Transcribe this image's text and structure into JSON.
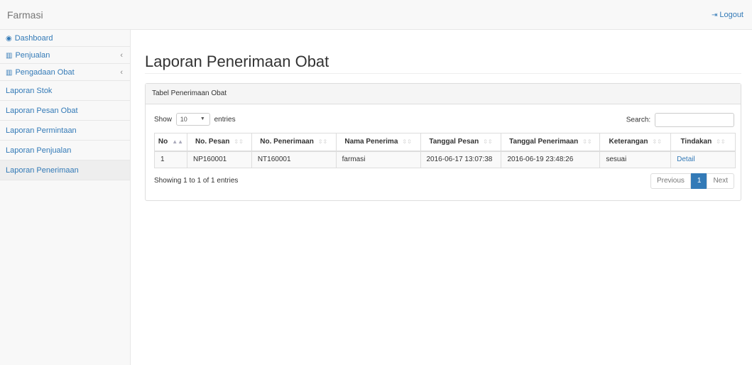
{
  "brand": "Farmasi",
  "logout_label": "Logout",
  "sidebar": {
    "items": [
      {
        "label": "Dashboard",
        "icon": "dashboard-icon"
      },
      {
        "label": "Penjualan",
        "icon": "bar-chart-icon",
        "chevron": "‹"
      },
      {
        "label": "Pengadaan Obat",
        "icon": "bar-chart-icon",
        "chevron": "‹"
      },
      {
        "label": "Laporan Stok"
      },
      {
        "label": "Laporan Pesan Obat"
      },
      {
        "label": "Laporan Permintaan"
      },
      {
        "label": "Laporan Penjualan"
      },
      {
        "label": "Laporan Penerimaan"
      }
    ]
  },
  "page_title": "Laporan Penerimaan Obat",
  "panel": {
    "heading": "Tabel Penerimaan Obat",
    "show_label": "Show",
    "entries_value": "10",
    "entries_label": "entries",
    "search_label": "Search:",
    "columns": [
      "No",
      "No. Pesan",
      "No. Penerimaan",
      "Nama Penerima",
      "Tanggal Pesan",
      "Tanggal Penerimaan",
      "Keterangan",
      "Tindakan"
    ],
    "rows": [
      {
        "no": "1",
        "no_pesan": "NP160001",
        "no_penerimaan": "NT160001",
        "nama_penerima": "farmasi",
        "tanggal_pesan": "2016-06-17 13:07:38",
        "tanggal_penerimaan": "2016-06-19 23:48:26",
        "keterangan": "sesuai",
        "tindakan": "Detail"
      }
    ],
    "info": "Showing 1 to 1 of 1 entries",
    "pagination": {
      "previous": "Previous",
      "current": "1",
      "next": "Next"
    }
  },
  "colors": {
    "link": "#337ab7",
    "active_page": "#337ab7"
  }
}
